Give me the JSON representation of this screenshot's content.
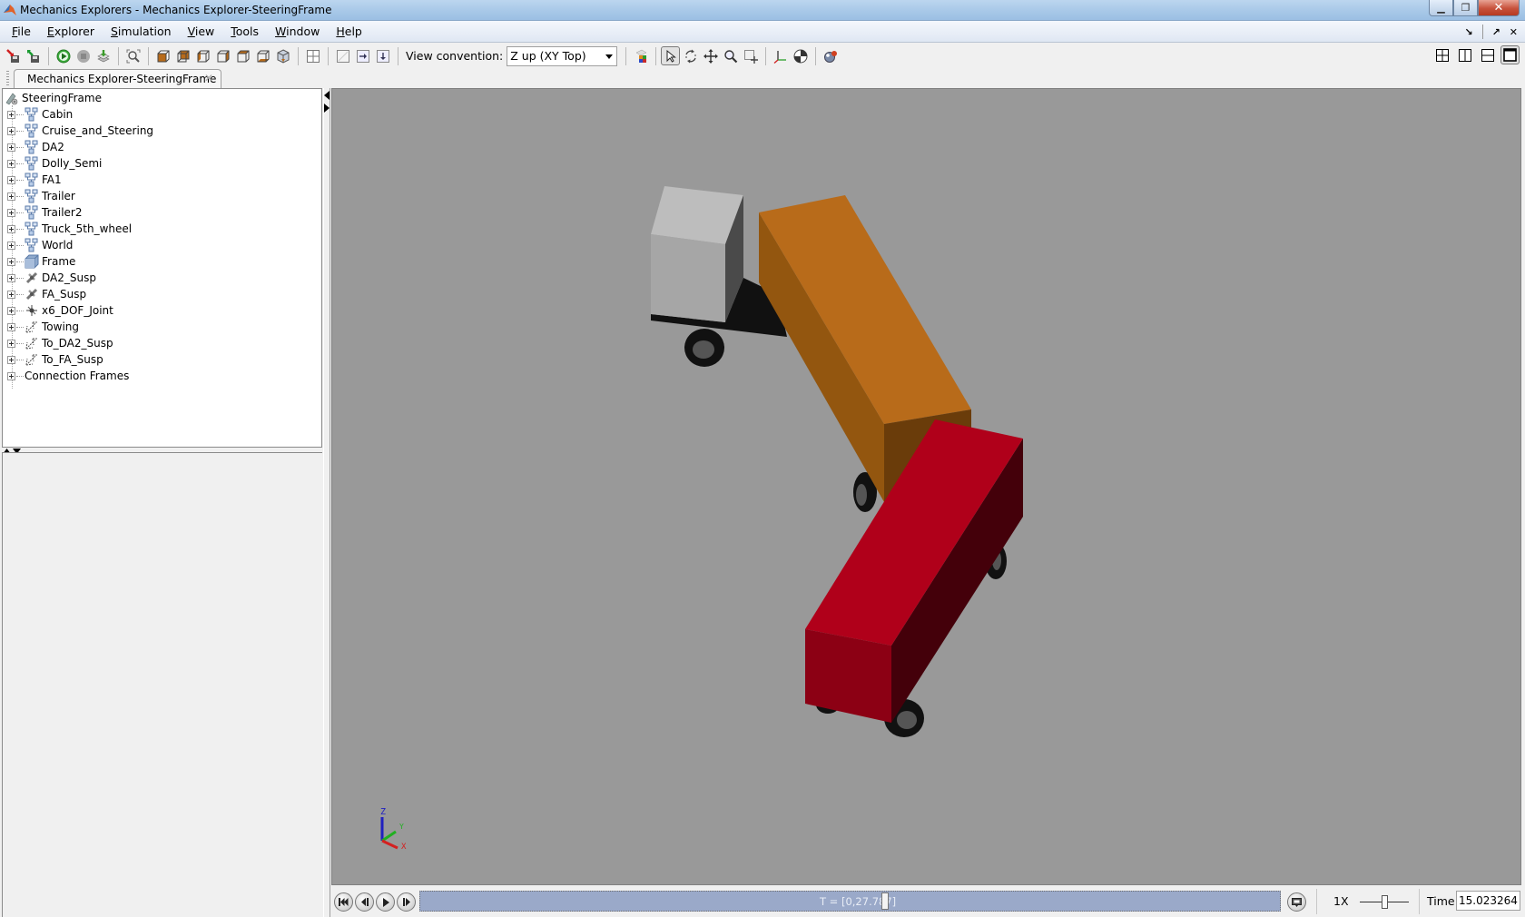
{
  "window": {
    "title": "Mechanics Explorers - Mechanics Explorer-SteeringFrame",
    "app_icon": "matlab-logo-icon",
    "controls": [
      "minimize",
      "restore",
      "close"
    ]
  },
  "menubar": {
    "items": [
      {
        "label": "File",
        "mnemonic": "F",
        "rest": "ile"
      },
      {
        "label": "Explorer",
        "mnemonic": "E",
        "rest": "xplorer"
      },
      {
        "label": "Simulation",
        "mnemonic": "S",
        "rest": "imulation"
      },
      {
        "label": "View",
        "mnemonic": "V",
        "rest": "iew"
      },
      {
        "label": "Tools",
        "mnemonic": "T",
        "rest": "ools"
      },
      {
        "label": "Window",
        "mnemonic": "W",
        "rest": "indow"
      },
      {
        "label": "Help",
        "mnemonic": "H",
        "rest": "elp"
      }
    ],
    "mdi_controls": [
      "undock-icon",
      "dock-icon",
      "close-icon"
    ]
  },
  "toolbar": {
    "view_convention_label": "View convention:",
    "view_convention_value": "Z up (XY Top)",
    "buttons": [
      "import-icon",
      "export-icon",
      "run-icon",
      "stop-icon",
      "update-icon",
      "fit-to-view-icon",
      "front-view-icon",
      "back-view-icon",
      "left-view-icon",
      "right-view-icon",
      "top-view-icon",
      "bottom-view-icon",
      "isometric-view-icon",
      "four-views-icon",
      "single-pane-icon",
      "split-right-icon",
      "split-down-icon",
      "color-settings-icon",
      "select-icon",
      "rotate-icon",
      "pan-icon",
      "zoom-icon",
      "zoom-box-icon",
      "frames-icon",
      "center-of-mass-icon",
      "convex-hull-icon"
    ],
    "layout_buttons": [
      "layout-four-icon",
      "layout-vertical-icon",
      "layout-horizontal-icon",
      "layout-single-icon"
    ]
  },
  "tab": {
    "label": "Mechanics Explorer-SteeringFrame"
  },
  "tree": {
    "root": "SteeringFrame",
    "items": [
      {
        "label": "Cabin",
        "icon": "subsystem-icon"
      },
      {
        "label": "Cruise_and_Steering",
        "icon": "subsystem-icon"
      },
      {
        "label": "DA2",
        "icon": "subsystem-icon"
      },
      {
        "label": "Dolly_Semi",
        "icon": "subsystem-icon"
      },
      {
        "label": "FA1",
        "icon": "subsystem-icon"
      },
      {
        "label": "Trailer",
        "icon": "subsystem-icon"
      },
      {
        "label": "Trailer2",
        "icon": "subsystem-icon"
      },
      {
        "label": "Truck_5th_wheel",
        "icon": "subsystem-icon"
      },
      {
        "label": "World",
        "icon": "subsystem-icon"
      },
      {
        "label": "Frame",
        "icon": "solid-icon"
      },
      {
        "label": "DA2_Susp",
        "icon": "joint-icon"
      },
      {
        "label": "FA_Susp",
        "icon": "joint-icon"
      },
      {
        "label": "x6_DOF_Joint",
        "icon": "six-dof-joint-icon"
      },
      {
        "label": "Towing",
        "icon": "transform-icon"
      },
      {
        "label": "To_DA2_Susp",
        "icon": "transform-icon"
      },
      {
        "label": "To_FA_Susp",
        "icon": "transform-icon"
      },
      {
        "label": "Connection Frames",
        "icon": "none"
      }
    ]
  },
  "viewport": {
    "background": "#999999",
    "scene": {
      "cab_color": "#c8c8c8",
      "trailer1_color": "#b86b1a",
      "trailer2_color": "#b0001a",
      "wheel_color": "#111111"
    },
    "triad": {
      "x": "X",
      "y": "Y",
      "z": "Z",
      "x_color": "#d42020",
      "y_color": "#20b020",
      "z_color": "#2020c0"
    }
  },
  "playback": {
    "time_range_label": "T = [0,27.787]",
    "progress_fraction": 0.541,
    "speed_label": "1X",
    "speed_slider_fraction": 0.5,
    "time_label": "Time",
    "time_value": "15.023264",
    "buttons": [
      "skip-to-start-icon",
      "step-back-icon",
      "play-icon",
      "step-forward-icon"
    ]
  }
}
